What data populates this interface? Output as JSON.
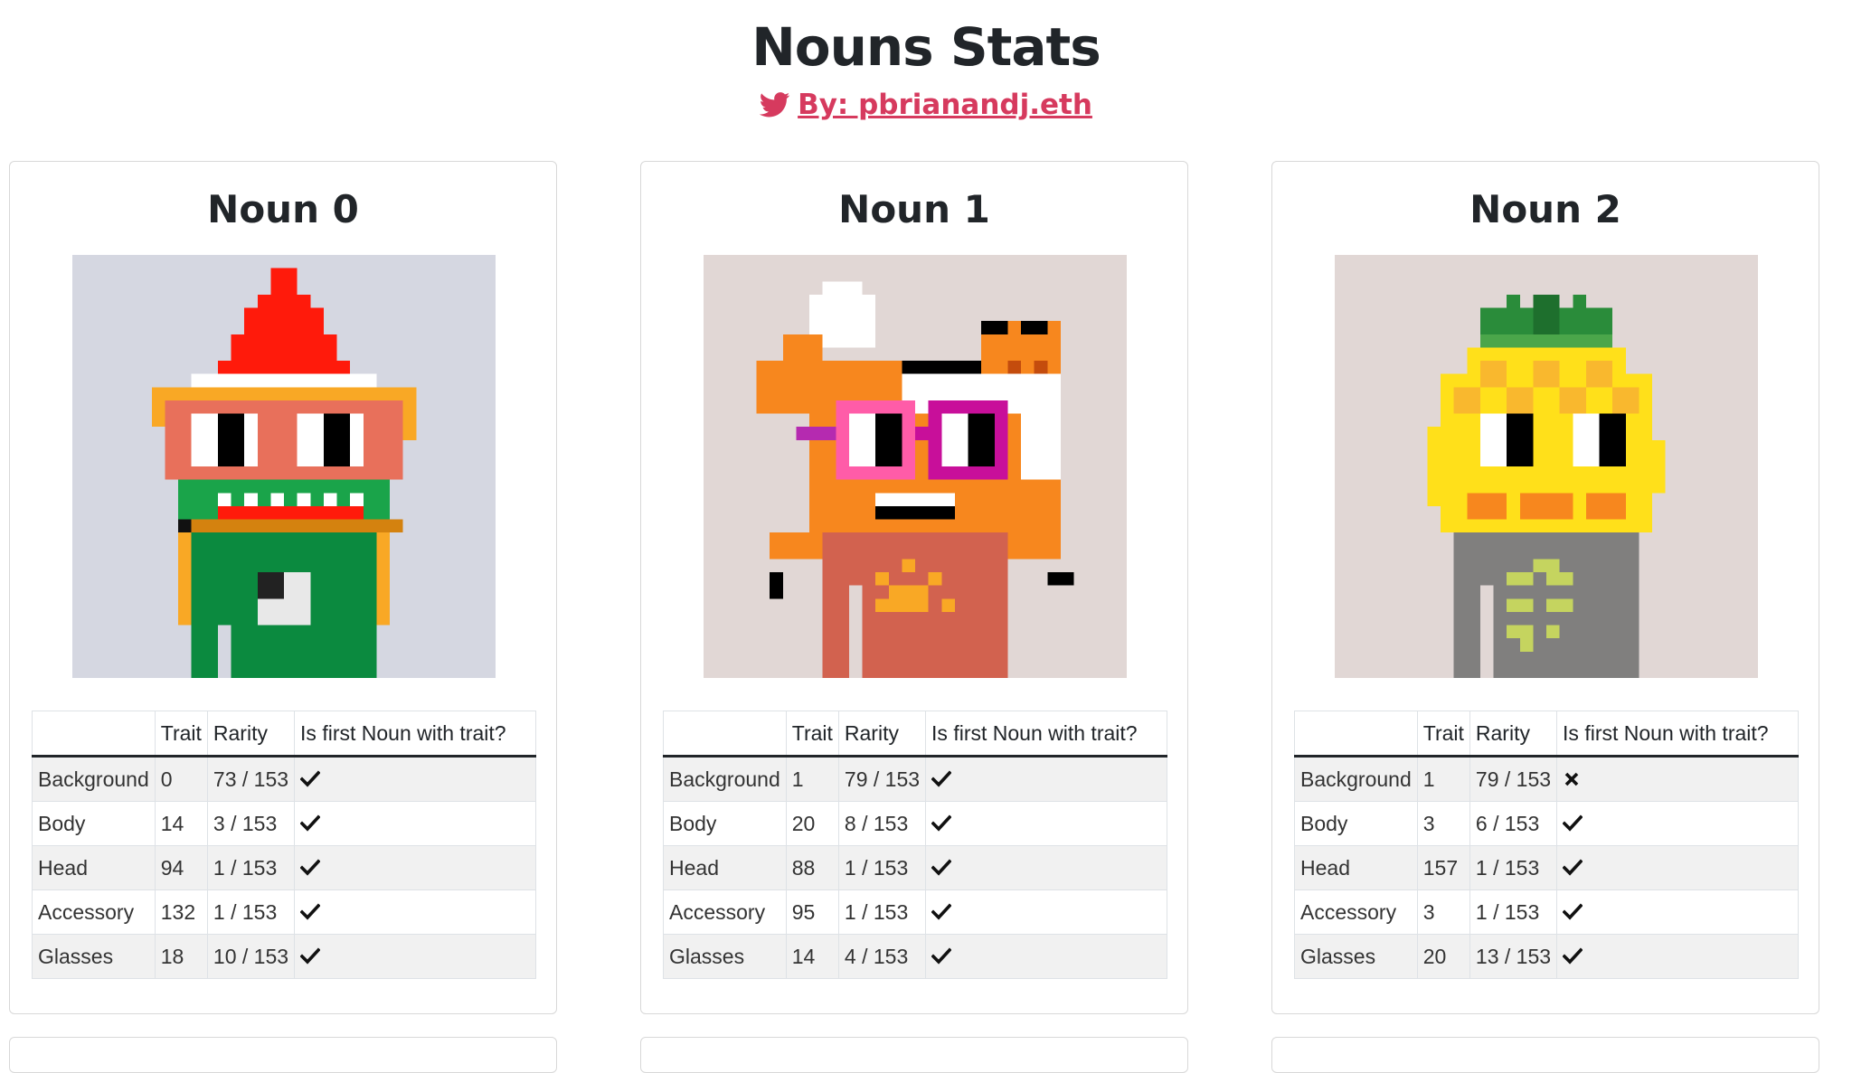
{
  "header": {
    "title": "Nouns Stats",
    "author_link": "By: pbrianandj.eth"
  },
  "colors": {
    "link": "#d63a5e",
    "background_cool": "#d5d7e1",
    "background_warm": "#e1d7d5"
  },
  "table_headers": [
    "",
    "Trait",
    "Rarity",
    "Is first Noun with trait?"
  ],
  "nouns": [
    {
      "title": "Noun 0",
      "image_background": "#d5d7e1",
      "rows": [
        {
          "name": "Background",
          "trait": "0",
          "rarity": "73 / 153",
          "first": true
        },
        {
          "name": "Body",
          "trait": "14",
          "rarity": "3 / 153",
          "first": true
        },
        {
          "name": "Head",
          "trait": "94",
          "rarity": "1 / 153",
          "first": true
        },
        {
          "name": "Accessory",
          "trait": "132",
          "rarity": "1 / 153",
          "first": true
        },
        {
          "name": "Glasses",
          "trait": "18",
          "rarity": "10 / 153",
          "first": true
        }
      ]
    },
    {
      "title": "Noun 1",
      "image_background": "#e1d7d5",
      "rows": [
        {
          "name": "Background",
          "trait": "1",
          "rarity": "79 / 153",
          "first": true
        },
        {
          "name": "Body",
          "trait": "20",
          "rarity": "8 / 153",
          "first": true
        },
        {
          "name": "Head",
          "trait": "88",
          "rarity": "1 / 153",
          "first": true
        },
        {
          "name": "Accessory",
          "trait": "95",
          "rarity": "1 / 153",
          "first": true
        },
        {
          "name": "Glasses",
          "trait": "14",
          "rarity": "4 / 153",
          "first": true
        }
      ]
    },
    {
      "title": "Noun 2",
      "image_background": "#e1d7d5",
      "rows": [
        {
          "name": "Background",
          "trait": "1",
          "rarity": "79 / 153",
          "first": false
        },
        {
          "name": "Body",
          "trait": "3",
          "rarity": "6 / 153",
          "first": true
        },
        {
          "name": "Head",
          "trait": "157",
          "rarity": "1 / 153",
          "first": true
        },
        {
          "name": "Accessory",
          "trait": "3",
          "rarity": "1 / 153",
          "first": true
        },
        {
          "name": "Glasses",
          "trait": "20",
          "rarity": "13 / 153",
          "first": true
        }
      ]
    }
  ]
}
